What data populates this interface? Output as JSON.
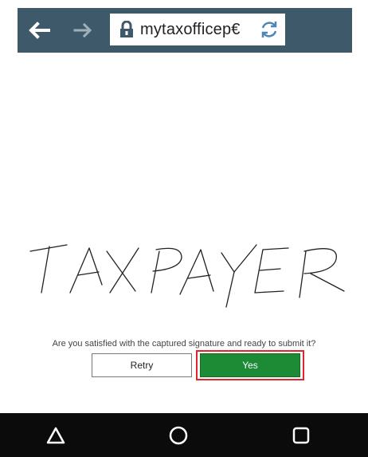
{
  "browser": {
    "url": "mytaxofficep€",
    "back_icon": "arrow-left-icon",
    "forward_icon": "arrow-right-icon",
    "lock_icon": "lock-icon",
    "reload_icon": "reload-icon",
    "bar_color": "#3e5a6a"
  },
  "signature": {
    "text": "TAXPAYER"
  },
  "prompt": {
    "text": "Are you satisfied with the captured signature and ready to submit it?"
  },
  "buttons": {
    "retry_label": "Retry",
    "yes_label": "Yes",
    "yes_color": "#1d8a36",
    "highlight_color": "#e0262a"
  },
  "system_nav": {
    "back_icon": "triangle-back-icon",
    "home_icon": "circle-home-icon",
    "recents_icon": "square-recents-icon"
  }
}
